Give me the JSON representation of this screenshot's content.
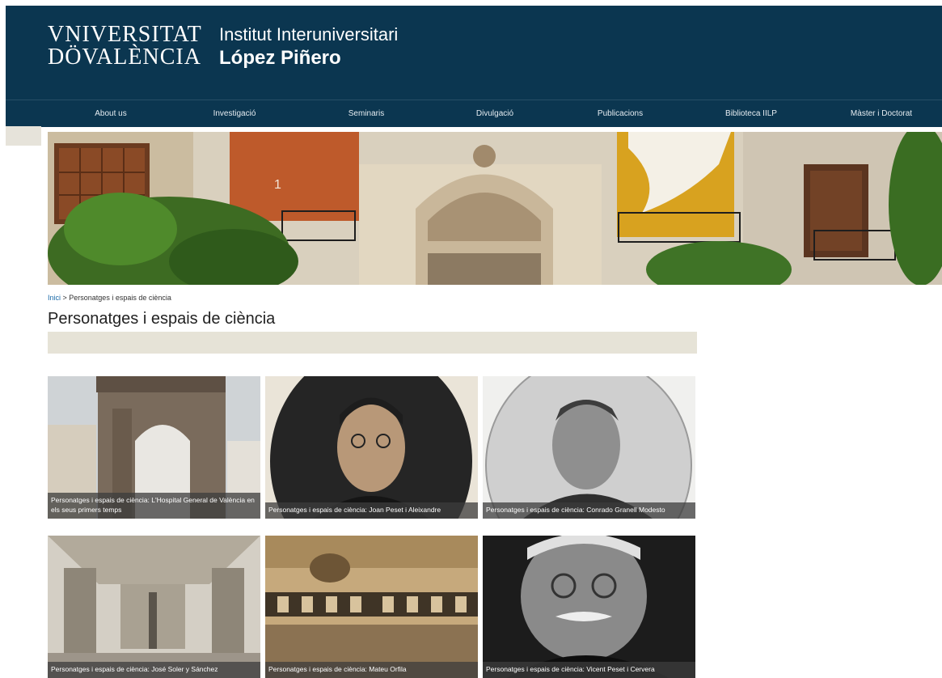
{
  "header": {
    "university_logo_line1": "VNIVERSITAT",
    "university_logo_line2": "DÖVALÈNCIA",
    "institute_line1": "Institut Interuniversitari",
    "institute_line2": "López Piñero"
  },
  "nav": {
    "items": [
      {
        "label": "About us"
      },
      {
        "label": "Investigació"
      },
      {
        "label": "Seminaris"
      },
      {
        "label": "Divulgació"
      },
      {
        "label": "Publicacions"
      },
      {
        "label": "Biblioteca IILP"
      },
      {
        "label": "Màster i Doctorat"
      }
    ]
  },
  "breadcrumb": {
    "home": "Inici",
    "separator": " > ",
    "current": "Personatges i espais de ciència"
  },
  "page": {
    "title": "Personatges i espais de ciència"
  },
  "cards": [
    {
      "caption": "Personatges i espais de ciència: L'Hospital General de València en els seus primers temps"
    },
    {
      "caption": "Personatges i espais de ciència: Joan Peset i Aleixandre"
    },
    {
      "caption": "Personatges i espais de ciència: Conrado Granell Modesto"
    },
    {
      "caption": "Personatges i espais de ciència: José Soler y Sánchez"
    },
    {
      "caption": "Personatges i espais de ciència: Mateu Orfila"
    },
    {
      "caption": "Personatges i espais de ciència: Vicent Peset i Cervera"
    }
  ],
  "colors": {
    "header_bg": "#0b3650",
    "title_bar_bg": "#e6e3d7",
    "link": "#1a6aa8"
  }
}
